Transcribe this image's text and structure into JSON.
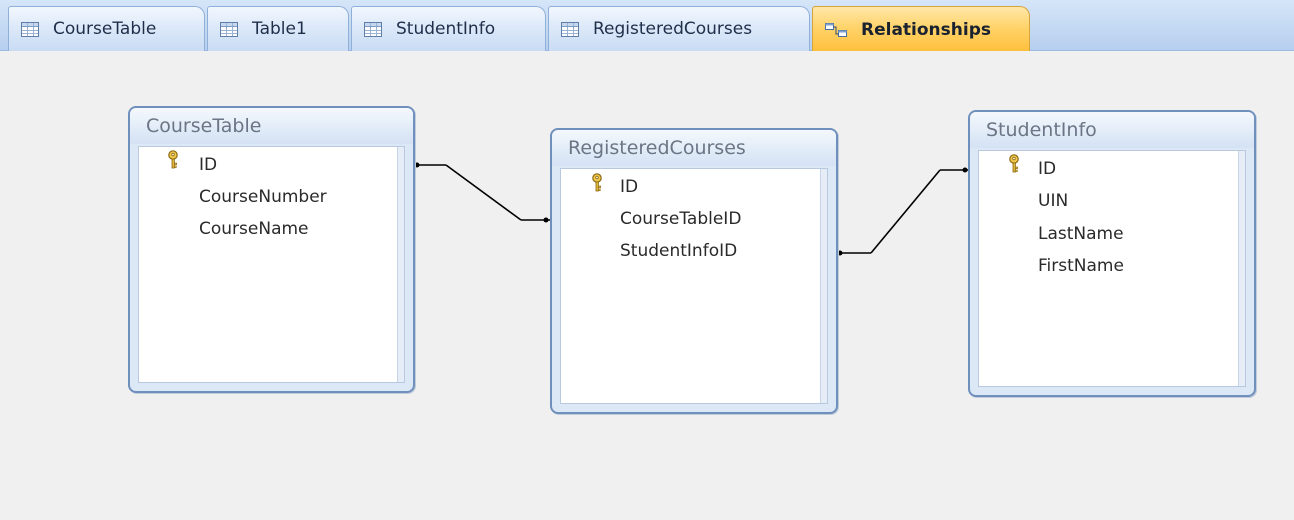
{
  "tabs": [
    {
      "label": "CourseTable",
      "icon": "table-icon",
      "active": false
    },
    {
      "label": "Table1",
      "icon": "table-icon",
      "active": false
    },
    {
      "label": "StudentInfo",
      "icon": "table-icon",
      "active": false
    },
    {
      "label": "RegisteredCourses",
      "icon": "table-icon",
      "active": false
    },
    {
      "label": "Relationships",
      "icon": "relationships-icon",
      "active": true
    }
  ],
  "tables": {
    "course_table": {
      "title": "CourseTable",
      "fields": [
        "ID",
        "CourseNumber",
        "CourseName"
      ],
      "primary_key": "ID"
    },
    "registered_courses": {
      "title": "RegisteredCourses",
      "fields": [
        "ID",
        "CourseTableID",
        "StudentInfoID"
      ],
      "primary_key": "ID"
    },
    "student_info": {
      "title": "StudentInfo",
      "fields": [
        "ID",
        "UIN",
        "LastName",
        "FirstName"
      ],
      "primary_key": "ID"
    }
  },
  "relationships": [
    {
      "from": "CourseTable.ID",
      "to": "RegisteredCourses.CourseTableID"
    },
    {
      "from": "RegisteredCourses.StudentInfoID",
      "to": "StudentInfo.ID"
    }
  ],
  "colors": {
    "active_tab": "#ffc84a",
    "tab_bar": "#c4d9f3",
    "field_list_border": "#6f8fbd",
    "field_list_title": "#6b7585",
    "field_text": "#2a2a2a",
    "key_icon": "#d4a52a"
  }
}
